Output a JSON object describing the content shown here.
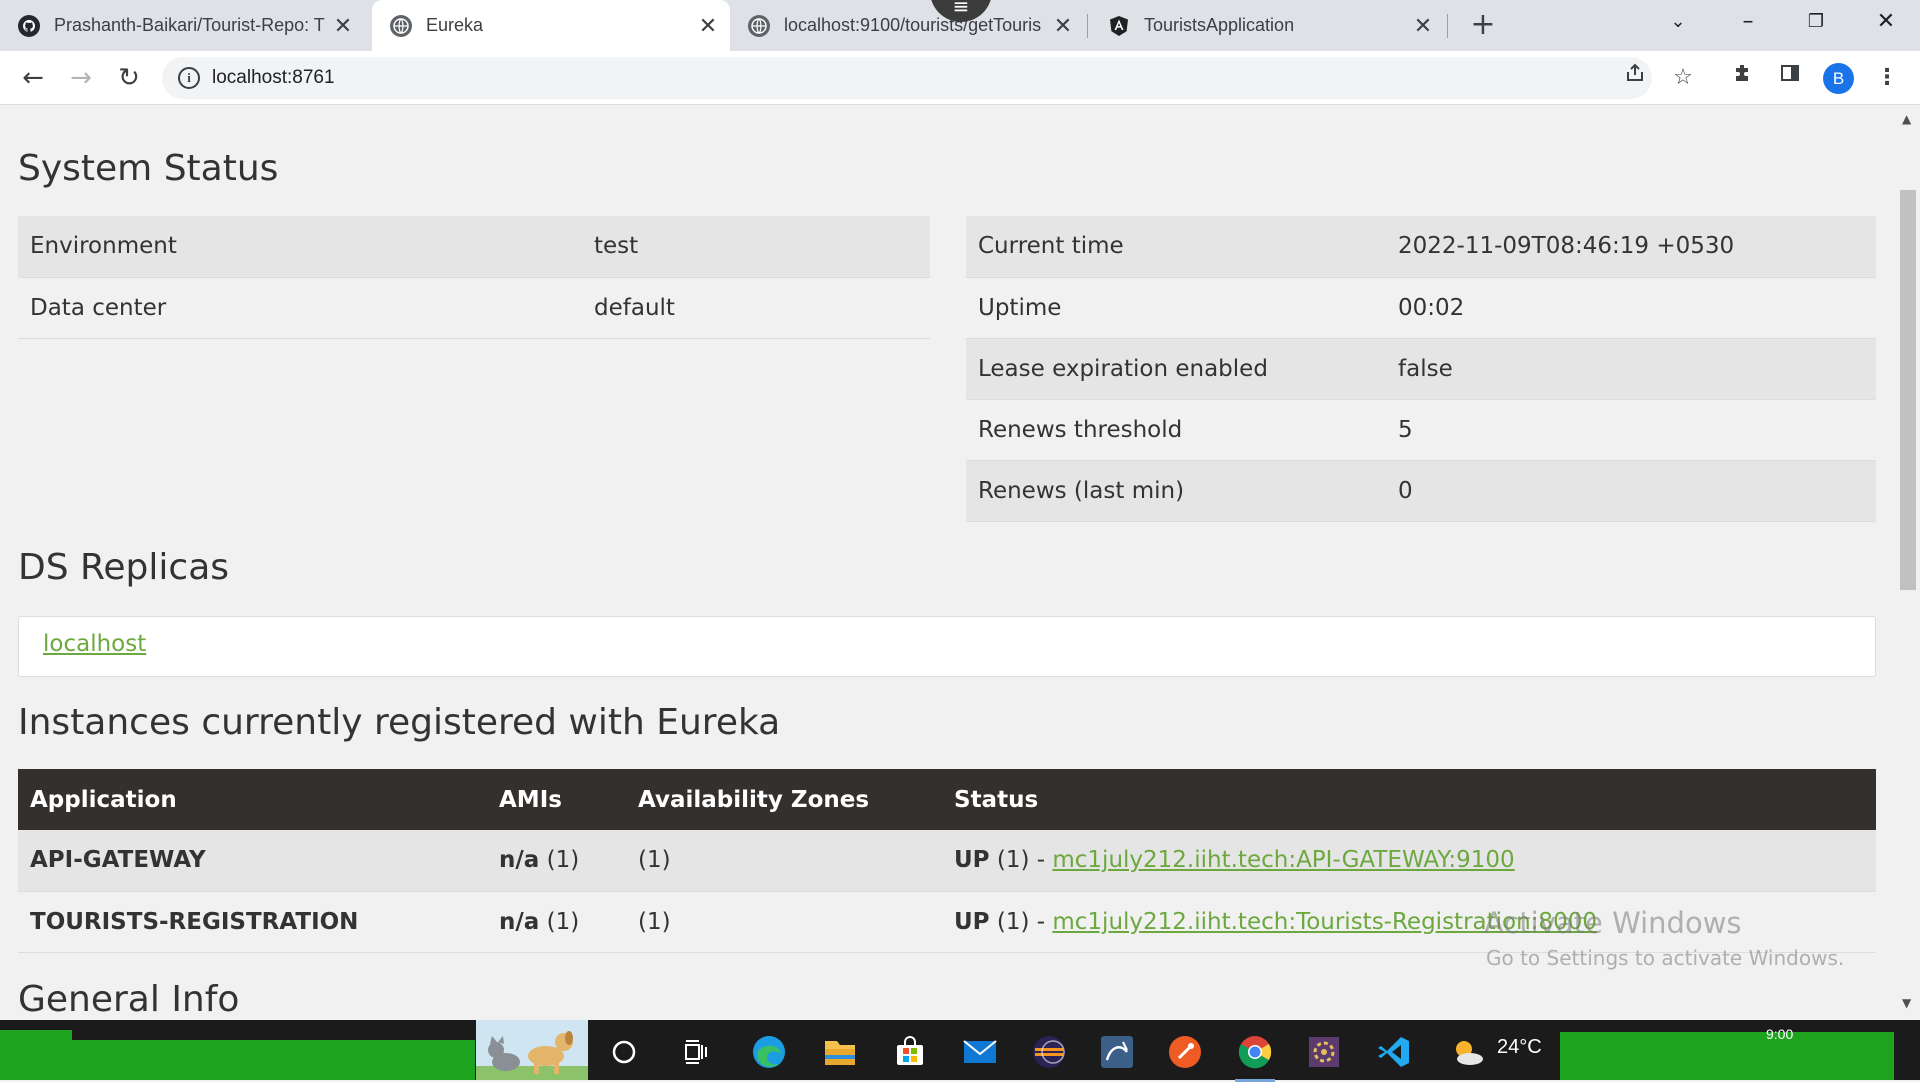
{
  "browser": {
    "tabs": [
      {
        "title": "Prashanth-Baikari/Tourist-Repo: T",
        "icon": "github-icon",
        "active": false
      },
      {
        "title": "Eureka",
        "icon": "globe-icon",
        "active": true
      },
      {
        "title": "localhost:9100/tourists/getTouris",
        "icon": "globe-icon",
        "active": false
      },
      {
        "title": "TouristsApplication",
        "icon": "angular-icon",
        "active": false
      }
    ],
    "url": "localhost:8761",
    "profile_initial": "B"
  },
  "system_status": {
    "heading": "System Status",
    "left": [
      {
        "label": "Environment",
        "value": "test"
      },
      {
        "label": "Data center",
        "value": "default"
      }
    ],
    "right": [
      {
        "label": "Current time",
        "value": "2022-11-09T08:46:19 +0530"
      },
      {
        "label": "Uptime",
        "value": "00:02"
      },
      {
        "label": "Lease expiration enabled",
        "value": "false"
      },
      {
        "label": "Renews threshold",
        "value": "5"
      },
      {
        "label": "Renews (last min)",
        "value": "0"
      }
    ]
  },
  "ds_replicas": {
    "heading": "DS Replicas",
    "link": "localhost"
  },
  "instances": {
    "heading": "Instances currently registered with Eureka",
    "columns": [
      "Application",
      "AMIs",
      "Availability Zones",
      "Status"
    ],
    "rows": [
      {
        "application": "API-GATEWAY",
        "amis_bold": "n/a",
        "amis_count": "(1)",
        "zones": "(1)",
        "status_prefix": "UP",
        "status_count": "(1) -",
        "status_link": "mc1july212.iiht.tech:API-GATEWAY:9100"
      },
      {
        "application": "TOURISTS-REGISTRATION",
        "amis_bold": "n/a",
        "amis_count": "(1)",
        "zones": "(1)",
        "status_prefix": "UP",
        "status_count": "(1) -",
        "status_link": "mc1july212.iiht.tech:Tourists-Registration:8000"
      }
    ]
  },
  "general_info": {
    "heading": "General Info"
  },
  "watermark": {
    "line1": "Activate Windows",
    "line2": "Go to Settings to activate Windows."
  },
  "taskbar": {
    "weather_temp": "24°C",
    "clock": "9:00"
  },
  "colors": {
    "link": "#6da83e",
    "table_header": "#34302d",
    "row_shade": "#e5e5e5"
  }
}
